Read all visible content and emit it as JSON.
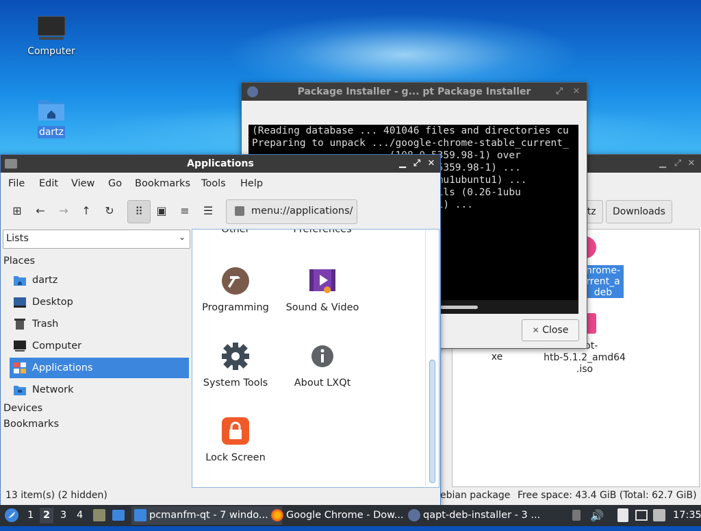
{
  "desktop": {
    "icons": [
      {
        "label": "Computer",
        "icon": "computer-icon"
      },
      {
        "label": "dartz",
        "icon": "home-folder-icon"
      }
    ]
  },
  "background_window": {
    "path_buttons": [
      "rtz",
      "Downloads"
    ],
    "files": [
      {
        "label_lines": [
          "hrome-",
          "rrent_a",
          "deb"
        ],
        "selected": true
      },
      {
        "label_lines": [
          "xe"
        ]
      },
      {
        "label_lines": [
          "t-bot-",
          "htb-5.1.2_amd64",
          ".iso"
        ]
      }
    ],
    "status_left": "ebian package",
    "status_right": "Free space: 43.4 GiB (Total: 62.7 GiB)"
  },
  "installer": {
    "title": "Package Installer - g...  pt Package Installer",
    "terminal_lines": [
      "(Reading database ... 401046 files and directories cu",
      "Preparing to unpack .../google-chrome-stable_current_",
      "                       (108.0.5359.98-1) over",
      "                      e (108.0.5359.98-1) ...",
      "                      p (3.70+nmu1ubuntu1) ...",
      "                      p-file-utils (0.26-1ubu",
      "                       (2.10.2-1) ..."
    ],
    "close_label": "Close"
  },
  "applications_window": {
    "title": "Applications",
    "menu": [
      "File",
      "Edit",
      "View",
      "Go",
      "Bookmarks",
      "Tools",
      "Help"
    ],
    "address": "menu://applications/",
    "side_dropdown": "Lists",
    "sections": {
      "places": "Places",
      "devices": "Devices",
      "bookmarks": "Bookmarks"
    },
    "places": [
      {
        "label": "dartz",
        "icon": "home-folder-icon"
      },
      {
        "label": "Desktop",
        "icon": "desktop-icon"
      },
      {
        "label": "Trash",
        "icon": "trash-icon"
      },
      {
        "label": "Computer",
        "icon": "computer-icon"
      },
      {
        "label": "Applications",
        "icon": "applications-icon",
        "selected": true
      },
      {
        "label": "Network",
        "icon": "network-folder-icon"
      }
    ],
    "partial_items": [
      "Other",
      "Preferences"
    ],
    "items": [
      {
        "label": "Programming",
        "icon": "programming-hammer-icon"
      },
      {
        "label": "Sound & Video",
        "icon": "sound-video-icon"
      },
      {
        "label": "System Tools",
        "icon": "system-tools-gear-icon"
      },
      {
        "label": "About LXQt",
        "icon": "info-icon"
      },
      {
        "label": "Lock Screen",
        "icon": "lock-screen-icon"
      }
    ],
    "status": "13 item(s) (2 hidden)"
  },
  "taskbar": {
    "workspaces": [
      "1",
      "2",
      "3",
      "4"
    ],
    "active_workspace": "2",
    "tasks": [
      {
        "label": "pcmanfm-qt - 7 windo...",
        "icon": "folder-icon",
        "active": true
      },
      {
        "label": "Google Chrome - Dow...",
        "icon": "firefox-icon"
      },
      {
        "label": "qapt-deb-installer - 3 ...",
        "icon": "installer-icon"
      }
    ],
    "clock": "17:35"
  },
  "colors": {
    "selection": "#3c86de",
    "taskbar": "#2b2f36",
    "titlebar": "#3a3a3a"
  }
}
